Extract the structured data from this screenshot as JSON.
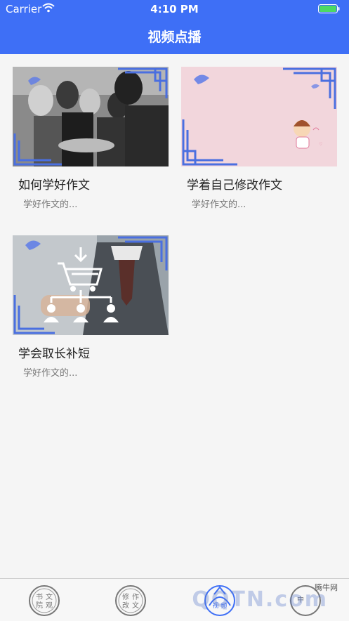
{
  "status_bar": {
    "carrier": "Carrier",
    "time": "4:10 PM"
  },
  "header": {
    "title": "视频点播"
  },
  "videos": [
    {
      "title": "如何学好作文",
      "desc": "学好作文的..."
    },
    {
      "title": "学着自己修改作文",
      "desc": "学好作文的..."
    },
    {
      "title": "学会取长补短",
      "desc": "学好作文的..."
    }
  ],
  "tabs": [
    {
      "chars": [
        "书",
        "文",
        "院",
        "观"
      ],
      "icon": "calligraphy-seal-icon"
    },
    {
      "chars": [
        "修",
        "作",
        "改",
        "文"
      ],
      "icon": "calligraphy-seal-icon"
    },
    {
      "chars": [
        "视",
        "频"
      ],
      "icon": "video-seal-icon"
    },
    {
      "chars": [
        "中"
      ],
      "icon": "seal-icon"
    }
  ],
  "watermark": {
    "small": "腾牛网",
    "large": "QQTN.com"
  },
  "colors": {
    "accent": "#3e6ff6",
    "frame": "#4a6fe0",
    "pink": "#f2d6dc"
  }
}
